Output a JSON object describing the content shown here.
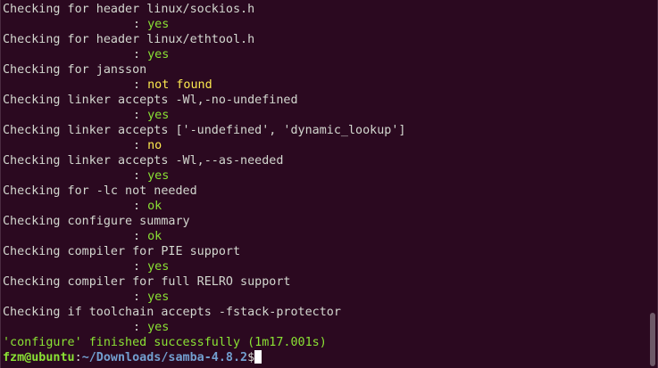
{
  "terminal": {
    "lines": [
      {
        "type": "check",
        "text": "Checking for header linux/sockios.h"
      },
      {
        "type": "result",
        "text": ": ",
        "value": "yes",
        "status": "ok"
      },
      {
        "type": "check",
        "text": "Checking for header linux/ethtool.h"
      },
      {
        "type": "result",
        "text": ": ",
        "value": "yes",
        "status": "ok"
      },
      {
        "type": "check",
        "text": "Checking for jansson"
      },
      {
        "type": "result",
        "text": ": ",
        "value": "not found",
        "status": "warn"
      },
      {
        "type": "check",
        "text": "Checking linker accepts -Wl,-no-undefined"
      },
      {
        "type": "result",
        "text": ": ",
        "value": "yes",
        "status": "ok"
      },
      {
        "type": "check",
        "text": "Checking linker accepts ['-undefined', 'dynamic_lookup']"
      },
      {
        "type": "result",
        "text": ": ",
        "value": "no",
        "status": "bad"
      },
      {
        "type": "check",
        "text": "Checking linker accepts -Wl,--as-needed"
      },
      {
        "type": "result",
        "text": ": ",
        "value": "yes",
        "status": "ok"
      },
      {
        "type": "check",
        "text": "Checking for -lc not needed"
      },
      {
        "type": "result",
        "text": ": ",
        "value": "ok",
        "status": "ok"
      },
      {
        "type": "check",
        "text": "Checking configure summary"
      },
      {
        "type": "result",
        "text": ": ",
        "value": "ok",
        "status": "ok"
      },
      {
        "type": "check",
        "text": "Checking compiler for PIE support"
      },
      {
        "type": "result",
        "text": ": ",
        "value": "yes",
        "status": "ok"
      },
      {
        "type": "check",
        "text": "Checking compiler for full RELRO support"
      },
      {
        "type": "result",
        "text": ": ",
        "value": "yes",
        "status": "ok"
      },
      {
        "type": "check",
        "text": "Checking if toolchain accepts -fstack-protector"
      },
      {
        "type": "result",
        "text": ": ",
        "value": "yes",
        "status": "ok"
      },
      {
        "type": "summary",
        "text": "'configure' finished successfully (1m17.001s)"
      }
    ],
    "prompt": {
      "user_host": "fzm@ubuntu",
      "separator": ":",
      "path": "~/Downloads/samba-4.8.2",
      "symbol": "$"
    }
  },
  "colors": {
    "background": "#2b0920",
    "text": "#d3d7cf",
    "ok": "#8ae234",
    "warn": "#fce94f",
    "path": "#729fcf"
  }
}
